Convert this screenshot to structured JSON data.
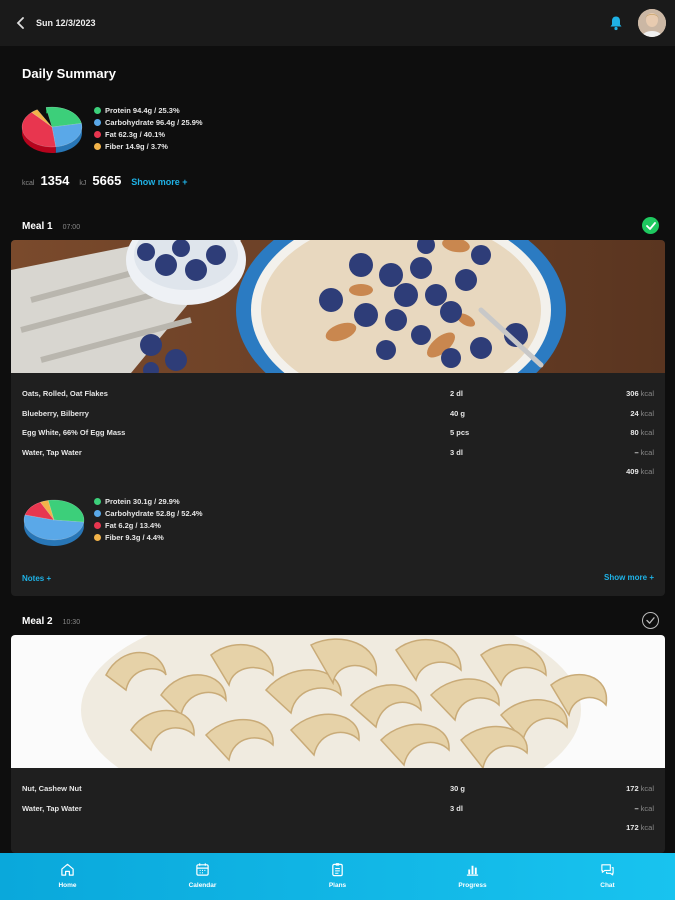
{
  "header": {
    "date": "Sun 12/3/2023"
  },
  "summary": {
    "title": "Daily Summary",
    "macros": [
      {
        "label": "Protein 94.4g / 25.3%",
        "color": "#3ccf7a",
        "fraction": 0.253
      },
      {
        "label": "Carbohydrate 96.4g / 25.9%",
        "color": "#5aa8e8",
        "fraction": 0.259
      },
      {
        "label": "Fat 62.3g / 40.1%",
        "color": "#e8364f",
        "fraction": 0.401
      },
      {
        "label": "Fiber 14.9g / 3.7%",
        "color": "#f2b34a",
        "fraction": 0.037
      }
    ],
    "kcal_unit": "kcal",
    "kcal": "1354",
    "kj_unit": "kJ",
    "kj": "5665",
    "show_more": "Show more +"
  },
  "meals": [
    {
      "title": "Meal 1",
      "time": "07:00",
      "done": true,
      "photo": "oatmeal-blueberries-almonds",
      "foods": [
        {
          "name": "Oats, Rolled, Oat Flakes",
          "qty": "2 dl",
          "kcal": "306",
          "unit": "kcal"
        },
        {
          "name": "Blueberry, Bilberry",
          "qty": "40 g",
          "kcal": "24",
          "unit": "kcal"
        },
        {
          "name": "Egg White, 66% Of Egg Mass",
          "qty": "5 pcs",
          "kcal": "80",
          "unit": "kcal"
        },
        {
          "name": "Water, Tap Water",
          "qty": "3 dl",
          "kcal": "–",
          "unit": "kcal"
        }
      ],
      "total": "409",
      "total_unit": "kcal",
      "macros": [
        {
          "label": "Protein 30.1g / 29.9%",
          "color": "#3ccf7a",
          "fraction": 0.299
        },
        {
          "label": "Carbohydrate 52.8g / 52.4%",
          "color": "#5aa8e8",
          "fraction": 0.524
        },
        {
          "label": "Fat 6.2g / 13.4%",
          "color": "#e8364f",
          "fraction": 0.134
        },
        {
          "label": "Fiber 9.3g / 4.4%",
          "color": "#f2b34a",
          "fraction": 0.044
        }
      ],
      "notes": "Notes +",
      "show_more": "Show more +"
    },
    {
      "title": "Meal 2",
      "time": "10:30",
      "done": false,
      "photo": "cashew-nuts-bowl",
      "foods": [
        {
          "name": "Nut, Cashew Nut",
          "qty": "30 g",
          "kcal": "172",
          "unit": "kcal"
        },
        {
          "name": "Water, Tap Water",
          "qty": "3 dl",
          "kcal": "–",
          "unit": "kcal"
        }
      ],
      "total": "172",
      "total_unit": "kcal"
    }
  ],
  "nav": [
    {
      "label": "Home",
      "icon": "home-icon"
    },
    {
      "label": "Calendar",
      "icon": "calendar-icon"
    },
    {
      "label": "Plans",
      "icon": "clipboard-icon"
    },
    {
      "label": "Progress",
      "icon": "bar-chart-icon"
    },
    {
      "label": "Chat",
      "icon": "chat-icon"
    }
  ],
  "colors": {
    "accent": "#1fb2e6",
    "done": "#1ec85f",
    "background": "#0e0e0e",
    "card": "#1f1f1f"
  }
}
